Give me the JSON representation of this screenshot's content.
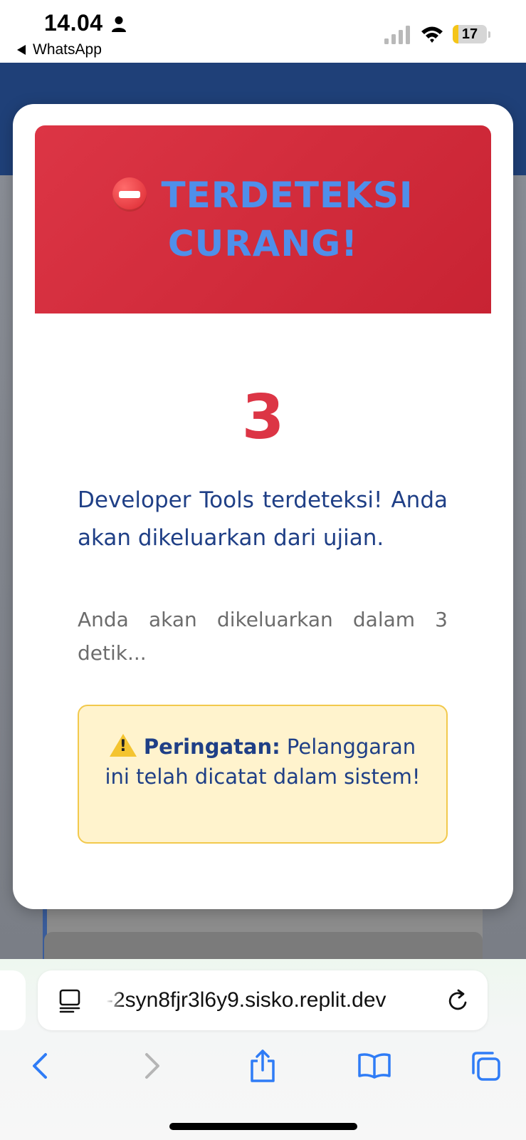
{
  "status_bar": {
    "time": "14.04",
    "back_app": "WhatsApp",
    "battery_level": "17",
    "icons": [
      "person-icon",
      "signal-icon",
      "wifi-icon",
      "battery-icon"
    ]
  },
  "modal": {
    "title": "TERDETEKSI CURANG!",
    "title_icon": "stop-icon",
    "countdown": "3",
    "message": "Developer Tools terdeteksi! Anda akan dikeluarkan dari ujian.",
    "sub_message": "Anda akan dikeluarkan dalam 3 detik...",
    "warning": {
      "icon": "warning-icon",
      "label": "Peringatan:",
      "text": " Pelanggaran ini telah dicatat dalam sistem!"
    },
    "colors": {
      "header_bg": "#dc3545",
      "title_text": "#4f8fea",
      "countdown": "#dc3545",
      "message_text": "#1f3f86",
      "warning_bg": "#fff3cd",
      "warning_border": "#f2c94c"
    }
  },
  "page": {
    "header_color": "#1f4078"
  },
  "browser": {
    "url": "-2syn8fjr3l6y9.sisko.replit.dev",
    "icons": [
      "reader-icon",
      "reload-icon",
      "back-icon",
      "forward-icon",
      "share-icon",
      "bookmarks-icon",
      "tabs-icon"
    ]
  }
}
